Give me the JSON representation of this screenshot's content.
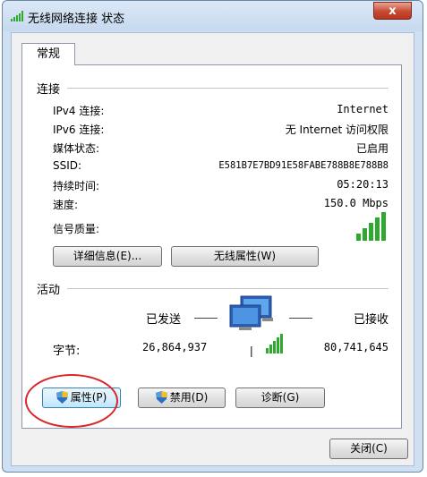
{
  "window": {
    "title": "无线网络连接 状态",
    "close_label": "x"
  },
  "tabs": [
    {
      "label": "常规"
    }
  ],
  "connection": {
    "group_title": "连接",
    "rows": [
      {
        "label": "IPv4 连接:",
        "value": "Internet"
      },
      {
        "label": "IPv6 连接:",
        "value": "无 Internet 访问权限"
      },
      {
        "label": "媒体状态:",
        "value": "已启用"
      },
      {
        "label": "SSID:",
        "value": "E581B7E7BD91E58FABE788B8E788B8"
      },
      {
        "label": "持续时间:",
        "value": "05:20:13"
      },
      {
        "label": "速度:",
        "value": "150.0 Mbps"
      }
    ],
    "signal_label": "信号质量:",
    "signal_bars": 5,
    "details_button": "详细信息(E)...",
    "wireless_props_button": "无线属性(W)"
  },
  "activity": {
    "group_title": "活动",
    "sent_label": "已发送",
    "received_label": "已接收",
    "bytes_label": "字节:",
    "bytes_sent": "26,864,937",
    "bytes_received": "80,741,645"
  },
  "actions": {
    "properties_button": "属性(P)",
    "disable_button": "禁用(D)",
    "diagnose_button": "诊断(G)"
  },
  "footer": {
    "close_button": "关闭(C)"
  },
  "colors": {
    "signal_green": "#2fa82f",
    "annotation_red": "#d9262b",
    "window_frame": "#cfe0f3"
  }
}
